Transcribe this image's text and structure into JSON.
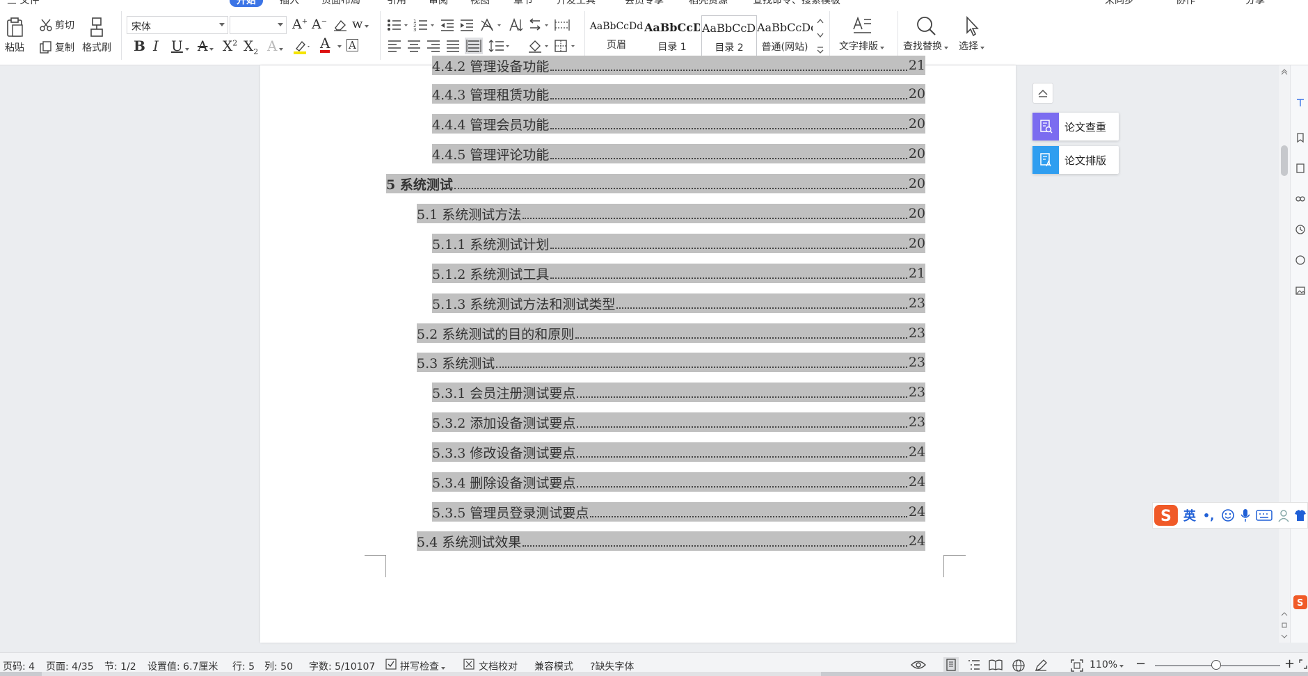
{
  "menubar": {
    "file": "三 文件",
    "home": "开始",
    "insert": "插入",
    "layout": "页面布局",
    "references": "引用",
    "review": "审阅",
    "view": "视图",
    "section": "章节",
    "dev": "开发工具",
    "member": "会员专享",
    "resources": "稻壳资源",
    "search_placeholder": "查找命令、搜索模板",
    "sync": "未同步",
    "collab": "协作",
    "share": "分享"
  },
  "clipboard": {
    "paste": "粘贴",
    "cut": "剪切",
    "copy": "复制",
    "format_painter": "格式刷"
  },
  "font": {
    "name": "宋体",
    "size": ""
  },
  "styles": {
    "items": [
      {
        "sample": "AaBbCcDd",
        "name": "页眉"
      },
      {
        "sample": "AaBbCcDd",
        "name": "目录 1"
      },
      {
        "sample": "AaBbCcDd",
        "name": "目录 2"
      },
      {
        "sample": "AaBbCcDd",
        "name": "普通(网站)"
      }
    ]
  },
  "tools": {
    "text_layout": "文字排版",
    "find_replace": "查找替换",
    "select": "选择"
  },
  "toc": [
    {
      "label": "4.4.2 管理设备功能",
      "page": "21"
    },
    {
      "label": "4.4.3 管理租赁功能",
      "page": "20"
    },
    {
      "label": "4.4.4 管理会员功能",
      "page": "20"
    },
    {
      "label": "4.4.5 管理评论功能",
      "page": "20"
    },
    {
      "label": "5 系统测试",
      "page": "20"
    },
    {
      "label": "5.1 系统测试方法",
      "page": "20"
    },
    {
      "label": "5.1.1 系统测试计划",
      "page": "20"
    },
    {
      "label": "5.1.2 系统测试工具",
      "page": "21"
    },
    {
      "label": "5.1.3 系统测试方法和测试类型",
      "page": "23"
    },
    {
      "label": "5.2 系统测试的目的和原则",
      "page": "23"
    },
    {
      "label": "5.3 系统测试",
      "page": "23"
    },
    {
      "label": "5.3.1 会员注册测试要点",
      "page": "23"
    },
    {
      "label": "5.3.2 添加设备测试要点",
      "page": "23"
    },
    {
      "label": "5.3.3 修改设备测试要点",
      "page": "24"
    },
    {
      "label": "5.3.4 删除设备测试要点",
      "page": "24"
    },
    {
      "label": "5.3.5 管理员登录测试要点",
      "page": "24"
    },
    {
      "label": "5.4 系统测试效果",
      "page": "24"
    }
  ],
  "side_panel": {
    "check": "论文查重",
    "format": "论文排版",
    "check_color": "#7b6cf0",
    "format_color": "#2f9ef0"
  },
  "ime": {
    "lang": "英"
  },
  "statusbar": {
    "page_code": "页码: 4",
    "page": "页面: 4/35",
    "section": "节: 1/2",
    "setting": "设置值: 6.7厘米",
    "row": "行: 5",
    "col": "列: 50",
    "word_count": "字数: 5/10107",
    "spell_check": "拼写检查",
    "proofread": "文档校对",
    "compat": "兼容模式",
    "missing_font": "缺失字体",
    "zoom": "110%"
  }
}
